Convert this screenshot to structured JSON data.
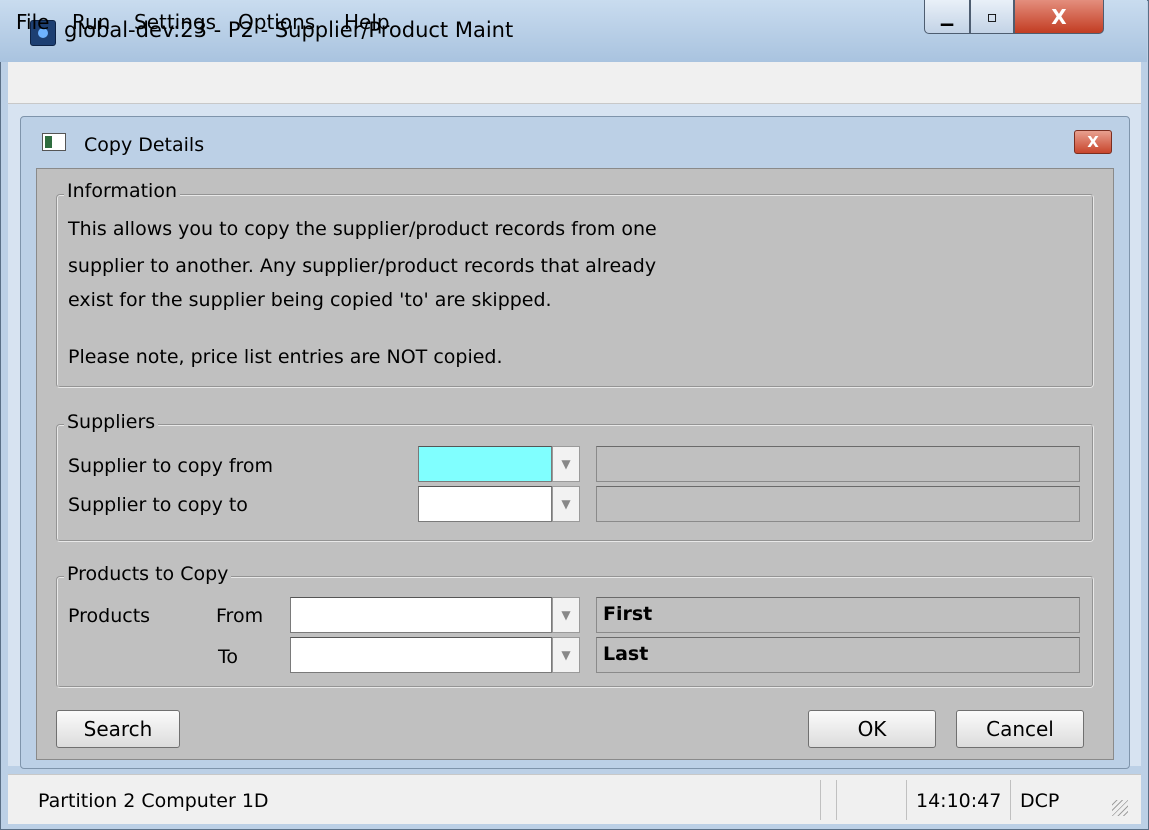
{
  "window": {
    "title": "global-dev:23 - P2 - Supplier/Product Maint",
    "close_glyph": "X"
  },
  "menu": [
    "File",
    "Run",
    "Settings",
    "Options",
    "Help"
  ],
  "dialog": {
    "title": "Copy Details",
    "close_glyph": "X",
    "information": {
      "label": "Information",
      "lines": [
        "This allows you to copy the supplier/product records from one",
        "supplier to another. Any supplier/product records that already",
        "exist for the supplier being copied 'to' are skipped.",
        "Please note, price list entries are NOT copied."
      ]
    },
    "suppliers": {
      "label": "Suppliers",
      "from_label": "Supplier to copy from",
      "to_label": "Supplier to copy to",
      "from_value": "",
      "to_value": "",
      "from_desc": "",
      "to_desc": ""
    },
    "products": {
      "label": "Products to Copy",
      "row_label": "Products",
      "from_label": "From",
      "to_label": "To",
      "from_value": "",
      "to_value": "",
      "from_desc": "First",
      "to_desc": "Last"
    },
    "buttons": {
      "search": "Search",
      "ok": "OK",
      "cancel": "Cancel"
    }
  },
  "status": {
    "partition": "Partition 2 Computer 1D",
    "time": "14:10:47",
    "mode": "DCP"
  },
  "colors": {
    "active_field": "#80ffff",
    "dialog_bg": "#c0c0c0",
    "frame": "#bcd0e6"
  }
}
